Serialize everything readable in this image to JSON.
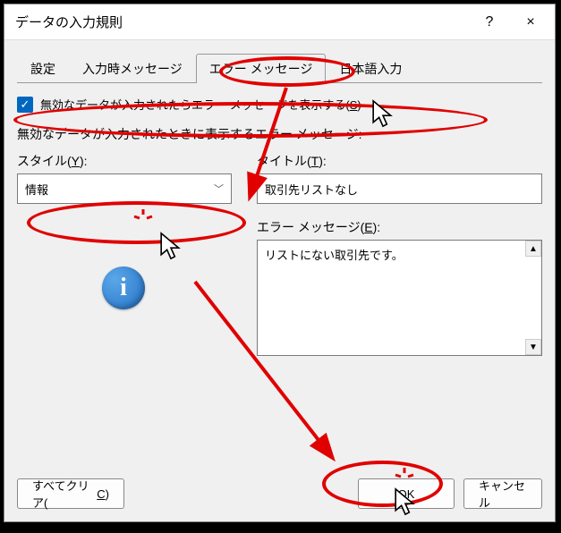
{
  "window": {
    "title": "データの入力規則",
    "help_icon": "?",
    "close_icon": "×"
  },
  "tabs": {
    "settings": "設定",
    "input_msg": "入力時メッセージ",
    "error_msg": "エラー メッセージ",
    "ime": "日本語入力"
  },
  "checkbox": {
    "label": "無効なデータが入力されたらエラー メッセージを表示する(",
    "key": "S",
    "label_end": ")"
  },
  "subheading": "無効なデータが入力されたときに表示するエラー メッセージ:",
  "style": {
    "label": "スタイル(",
    "key": "Y",
    "label_end": "):",
    "value": "情報"
  },
  "titlefield": {
    "label": "タイトル(",
    "key": "T",
    "label_end": "):",
    "value": "取引先リストなし"
  },
  "msgfield": {
    "label": "エラー メッセージ(",
    "key": "E",
    "label_end": "):",
    "value": "リストにない取引先です。"
  },
  "info_icon_glyph": "i",
  "buttons": {
    "clear": "すべてクリア(",
    "clear_key": "C",
    "clear_end": ")",
    "ok": "OK",
    "cancel": "キャンセル"
  }
}
